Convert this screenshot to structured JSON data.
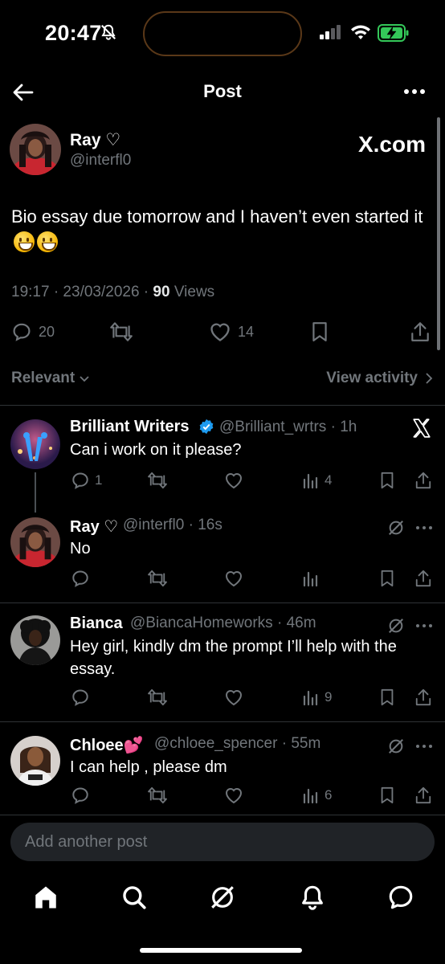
{
  "status_bar": {
    "time": "20:47"
  },
  "header": {
    "title": "Post"
  },
  "post": {
    "author_name": "Ray ♡",
    "author_handle": "@interfl0",
    "source_badge": "X.com",
    "text": "Bio essay due tomorrow and I haven’t even started it",
    "time": "19:17 · 23/03/2026 · ",
    "views_count": "90",
    "views_label": " Views",
    "reply_count": "20",
    "like_count": "14"
  },
  "filter": {
    "sort_label": "Relevant",
    "activity_label": "View activity"
  },
  "replies": [
    {
      "name": "Brilliant Writers",
      "handle": "@Brilliant_wrtrs · 1h",
      "text": "Can i work on it please?",
      "reply_count": "1",
      "views": "4",
      "verified": true
    },
    {
      "name": "Ray ♡",
      "handle": "@interfl0 · 16s",
      "text": "No",
      "reply_count": "",
      "views": ""
    },
    {
      "name": "Bianca",
      "handle": "@BiancaHomeworks · 46m",
      "text": "Hey girl, kindly dm the prompt I’ll help with the essay.",
      "reply_count": "",
      "views": "9"
    },
    {
      "name": "Chloee💕",
      "handle": "@chloee_spencer · 55m",
      "text": "I can help , please dm",
      "reply_count": "",
      "views": "6"
    }
  ],
  "composer": {
    "placeholder": "Add another post"
  },
  "colors": {
    "background": "#000000",
    "secondary_text": "#71767b",
    "verified_blue": "#1d9bf0",
    "divider": "#2f3336",
    "battery_green": "#34c759"
  }
}
